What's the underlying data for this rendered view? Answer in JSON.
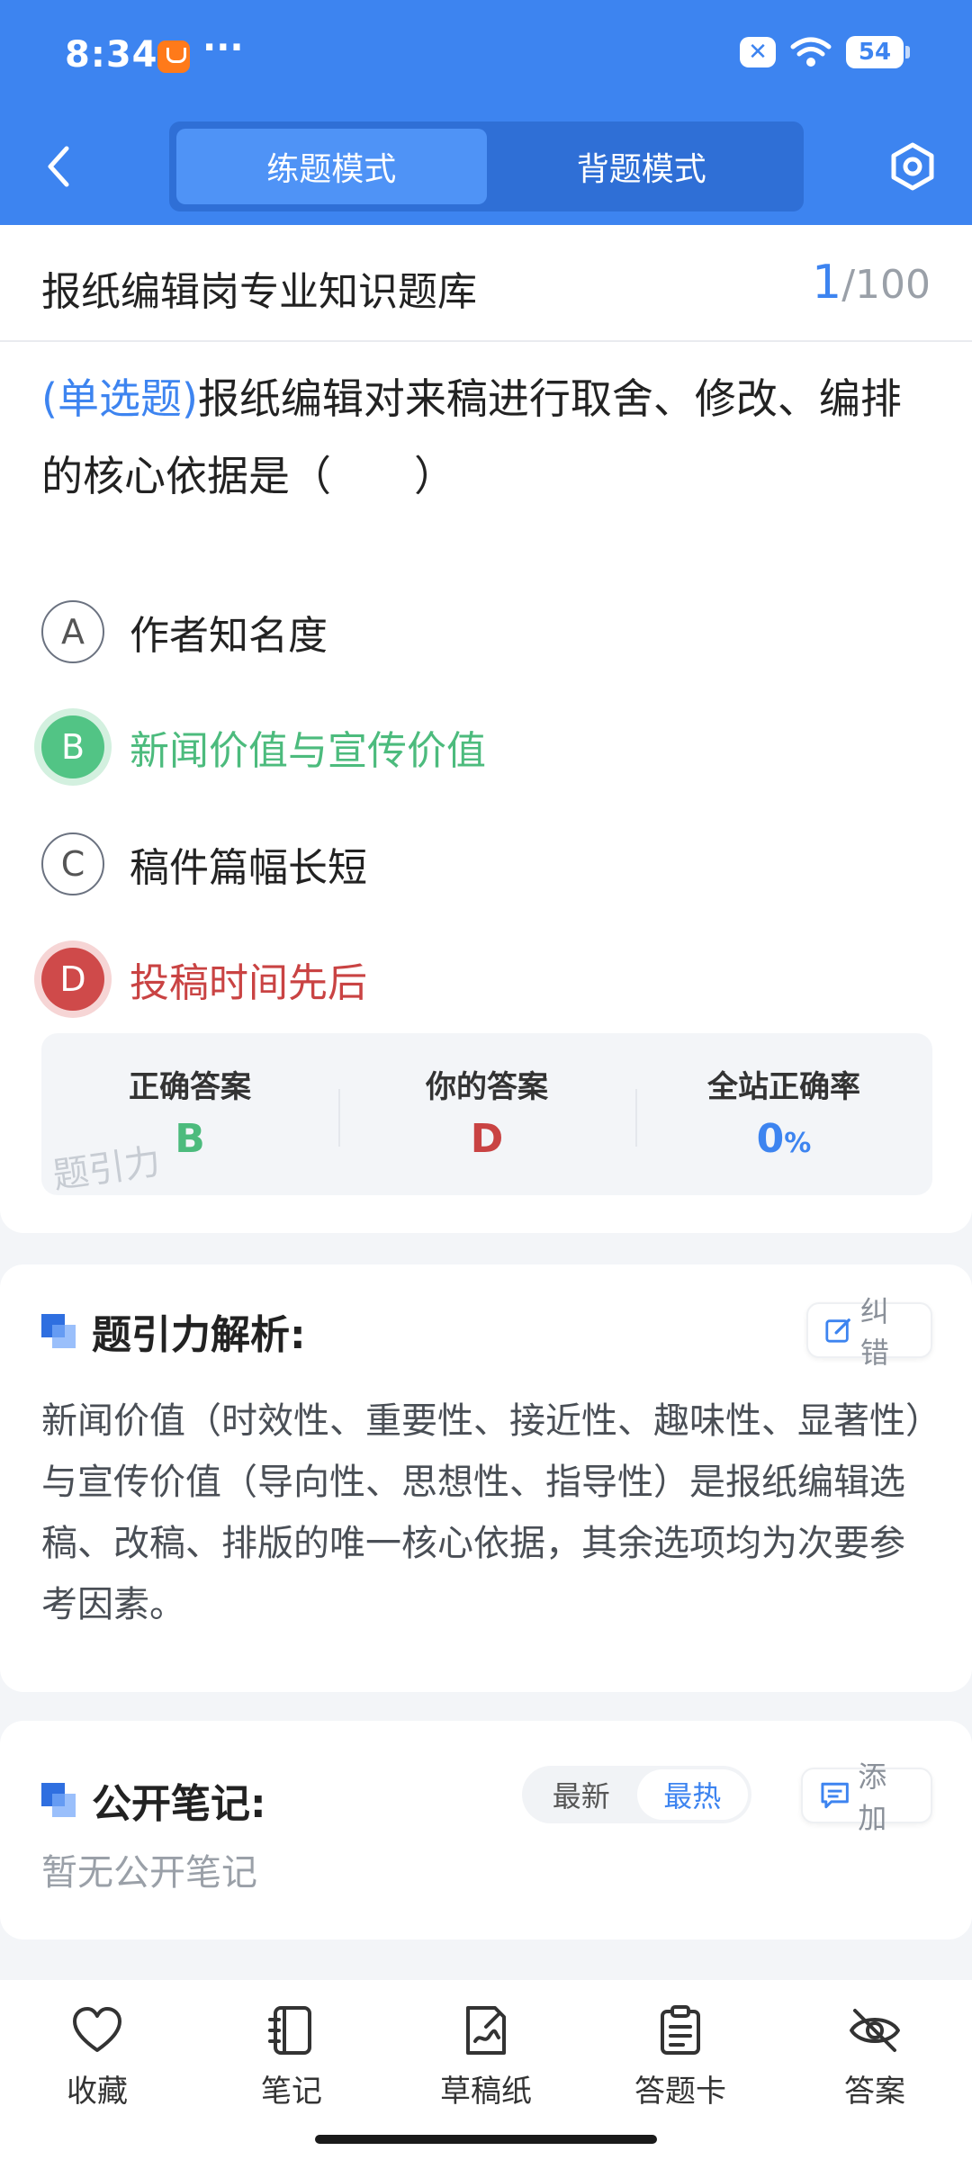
{
  "status_bar": {
    "time": "8:34",
    "dots": "···",
    "battery": "54"
  },
  "header": {
    "modes": [
      {
        "label": "练题模式",
        "active": true
      },
      {
        "label": "背题模式",
        "active": false
      }
    ]
  },
  "bank": {
    "title": "报纸编辑岗专业知识题库",
    "current": "1",
    "total": "/100"
  },
  "question": {
    "type": "(单选题)",
    "text": "报纸编辑对来稿进行取舍、修改、编排的核心依据是（　　）",
    "options": [
      {
        "letter": "A",
        "text": "作者知名度",
        "state": "normal"
      },
      {
        "letter": "B",
        "text": "新闻价值与宣传价值",
        "state": "correct"
      },
      {
        "letter": "C",
        "text": "稿件篇幅长短",
        "state": "normal"
      },
      {
        "letter": "D",
        "text": "投稿时间先后",
        "state": "wrong"
      }
    ]
  },
  "answer_summary": {
    "correct_label": "正确答案",
    "correct_value": "B",
    "yours_label": "你的答案",
    "yours_value": "D",
    "rate_label": "全站正确率",
    "rate_value": "0",
    "rate_unit": "%",
    "watermark": "题引力"
  },
  "analysis": {
    "title": "题引力解析:",
    "correct_button": "纠错",
    "text": "新闻价值（时效性、重要性、接近性、趣味性、显著性）与宣传价值（导向性、思想性、指导性）是报纸编辑选稿、改稿、排版的唯一核心依据，其余选项均为次要参考因素。"
  },
  "notes": {
    "title": "公开笔记:",
    "sort_options": [
      {
        "label": "最新",
        "active": false
      },
      {
        "label": "最热",
        "active": true
      }
    ],
    "add_button": "添加",
    "empty_text": "暂无公开笔记"
  },
  "bottom_bar": {
    "items": [
      {
        "label": "收藏",
        "icon": "heart-icon"
      },
      {
        "label": "笔记",
        "icon": "notebook-icon"
      },
      {
        "label": "草稿纸",
        "icon": "draft-paper-icon"
      },
      {
        "label": "答题卡",
        "icon": "answer-card-icon"
      },
      {
        "label": "答案",
        "icon": "eye-off-icon"
      }
    ]
  },
  "colors": {
    "primary": "#3d84f0",
    "correct": "#4cbb7d",
    "wrong": "#c94343"
  }
}
